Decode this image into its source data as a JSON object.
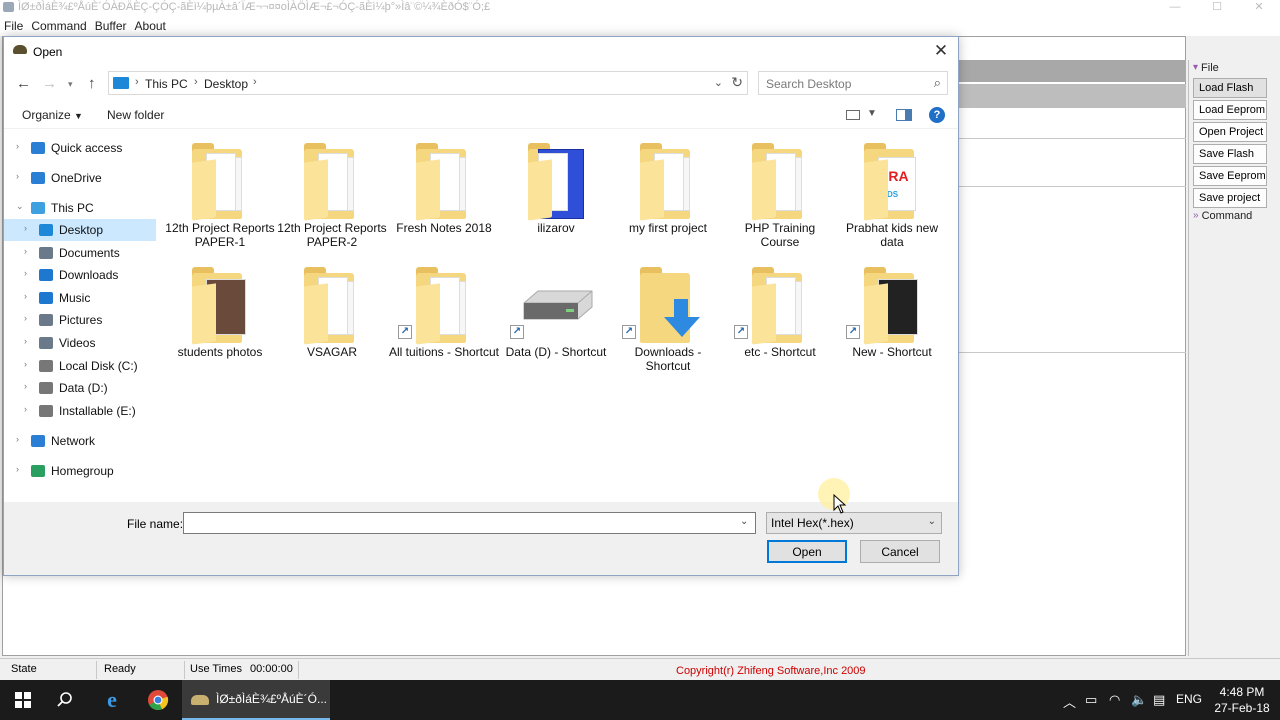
{
  "app": {
    "title": "ÌØ±ðÌáÈ¾£ºÅúÈ´ÓÀÐÄÈÇ-ÇÓÇ-ãÈì¼þµÀ±â´ÏÆ¬¬¤¤oÌÀÖÌÆ¬£¬ÓÇ-ãÈì¼þ°»Ìâ¨©¼¾ÈðÓ$¨Ó;£",
    "menu": [
      "File",
      "Command",
      "Buffer",
      "About"
    ],
    "side_panel": {
      "file_header": "File",
      "buttons": [
        "Load Flash",
        "Load Eeprom",
        "Open Project",
        "Save Flash",
        "Save Eeprom",
        "Save project"
      ],
      "command_header": "Command"
    },
    "status": {
      "state_label": "State",
      "state_value": "Ready",
      "use_times_label": "Use Times",
      "use_times_value": "00:00:00",
      "copyright": "Copyright(r) Zhifeng Software,Inc 2009",
      "copyright_color": "#cc0000"
    }
  },
  "dialog": {
    "title": "Open",
    "breadcrumb": [
      "This PC",
      "Desktop"
    ],
    "search_placeholder": "Search Desktop",
    "toolbar": {
      "organize": "Organize",
      "new_folder": "New folder",
      "help": "?"
    },
    "nav": [
      {
        "label": "Quick access",
        "icon": "star-icon",
        "color": "#2a7fd4"
      },
      {
        "label": "OneDrive",
        "icon": "cloud-icon",
        "color": "#2a7fd4"
      },
      {
        "label": "This PC",
        "icon": "computer-icon",
        "color": "#3fa0e0"
      },
      {
        "label": "Desktop",
        "icon": "desktop-icon",
        "color": "#1e88d8",
        "selected": true
      },
      {
        "label": "Documents",
        "icon": "documents-icon",
        "color": "#6a7a8a"
      },
      {
        "label": "Downloads",
        "icon": "download-icon",
        "color": "#1e78d0"
      },
      {
        "label": "Music",
        "icon": "music-icon",
        "color": "#1e78d0"
      },
      {
        "label": "Pictures",
        "icon": "pictures-icon",
        "color": "#6a7a8a"
      },
      {
        "label": "Videos",
        "icon": "videos-icon",
        "color": "#6a7a8a"
      },
      {
        "label": "Local Disk (C:)",
        "icon": "drive-icon",
        "color": "#777777"
      },
      {
        "label": "Data (D:)",
        "icon": "drive-icon",
        "color": "#777777"
      },
      {
        "label": "Installable (E:)",
        "icon": "drive-icon",
        "color": "#777777"
      },
      {
        "label": "Network",
        "icon": "network-icon",
        "color": "#2a7fd4"
      },
      {
        "label": "Homegroup",
        "icon": "homegroup-icon",
        "color": "#2aa060"
      }
    ],
    "files": [
      {
        "name": "12th Project Reports PAPER-1",
        "type": "folder",
        "shortcut": false
      },
      {
        "name": "12th Project Reports PAPER-2",
        "type": "folder",
        "shortcut": false
      },
      {
        "name": "Fresh Notes 2018",
        "type": "folder",
        "shortcut": false
      },
      {
        "name": "ilizarov",
        "type": "folder-blue",
        "shortcut": false
      },
      {
        "name": "my first project",
        "type": "folder",
        "shortcut": false
      },
      {
        "name": "PHP Training Course",
        "type": "folder",
        "shortcut": false
      },
      {
        "name": "Prabhat kids new data",
        "type": "folder-image",
        "shortcut": false
      },
      {
        "name": "students photos",
        "type": "folder-photo",
        "shortcut": false
      },
      {
        "name": "VSAGAR",
        "type": "folder",
        "shortcut": false
      },
      {
        "name": "All tuitions - Shortcut",
        "type": "folder",
        "shortcut": true
      },
      {
        "name": "Data (D) - Shortcut",
        "type": "drive",
        "shortcut": true
      },
      {
        "name": "Downloads - Shortcut",
        "type": "downloads",
        "shortcut": true
      },
      {
        "name": "etc - Shortcut",
        "type": "folder",
        "shortcut": true
      },
      {
        "name": "New - Shortcut",
        "type": "folder-photo2",
        "shortcut": true
      }
    ],
    "footer": {
      "file_name_label": "File name:",
      "file_name_value": "",
      "file_type": "Intel Hex(*.hex)",
      "open": "Open",
      "cancel": "Cancel"
    }
  },
  "taskbar": {
    "app_label": "ÌØ±ðÌáÈ¾£ºÅúÈ´Ó...",
    "lang": "ENG",
    "time": "4:48 PM",
    "date": "27-Feb-18"
  }
}
